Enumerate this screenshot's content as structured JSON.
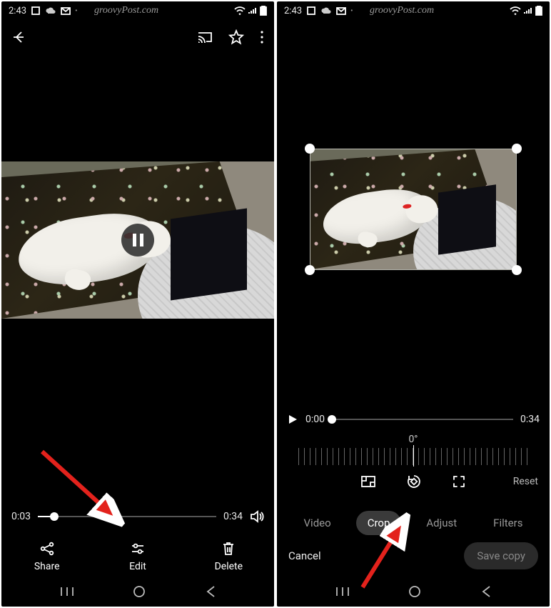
{
  "left": {
    "status": {
      "time": "2:43"
    },
    "watermark": "groovyPost.com",
    "scrubber": {
      "current": "0:03",
      "duration": "0:34",
      "progress_pct": 9
    },
    "actions": {
      "share": "Share",
      "edit": "Edit",
      "delete": "Delete"
    }
  },
  "right": {
    "status": {
      "time": "2:43"
    },
    "watermark": "groovyPost.com",
    "scrubber": {
      "current": "0:00",
      "duration": "0:34",
      "progress_pct": 0
    },
    "rotation": "0°",
    "reset": "Reset",
    "tabs": {
      "video": "Video",
      "crop": "Crop",
      "adjust": "Adjust",
      "filters": "Filters"
    },
    "footer": {
      "cancel": "Cancel",
      "save": "Save copy"
    }
  }
}
